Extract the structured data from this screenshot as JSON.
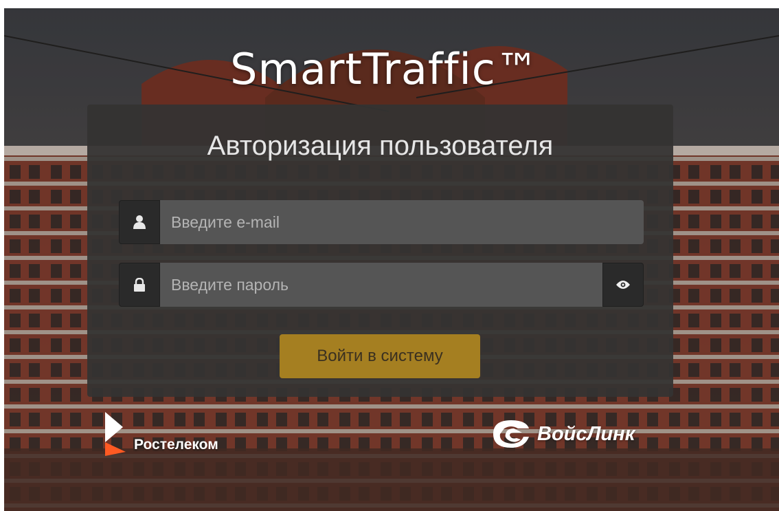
{
  "app": {
    "title": "SmartTraffic™"
  },
  "login": {
    "heading": "Авторизация пользователя",
    "email_placeholder": "Введите e-mail",
    "email_value": "",
    "password_placeholder": "Введите пароль",
    "password_value": "",
    "submit_label": "Войти в систему"
  },
  "icons": {
    "email": "user-icon",
    "password": "lock-icon",
    "toggle_password": "eye-icon"
  },
  "partners": [
    {
      "name": "Ростелеком"
    },
    {
      "name": "ВойсЛинк"
    }
  ],
  "colors": {
    "panel": "#343332",
    "addon": "#2a2a2a",
    "input": "#555555",
    "button": "#a57f21",
    "button_text": "#3a3020",
    "rt_orange": "#ff5a23"
  }
}
